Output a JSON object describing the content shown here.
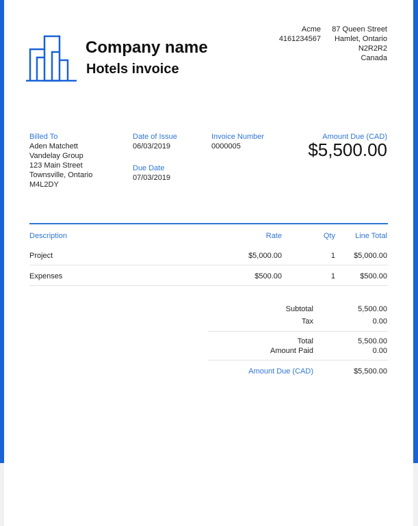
{
  "company": {
    "name": "Company name",
    "subtitle": "Hotels invoice"
  },
  "sender": {
    "name": "Acme",
    "phone": "4161234567",
    "address": [
      "87 Queen Street",
      "Hamlet, Ontario",
      "N2R2R2",
      "Canada"
    ]
  },
  "billed_to": {
    "label": "Billed To",
    "lines": [
      "Aden Matchett",
      "Vandelay Group",
      "123 Main Street",
      "Townsville, Ontario",
      "M4L2DY"
    ]
  },
  "dates": {
    "issue_label": "Date of Issue",
    "issue_value": "06/03/2019",
    "due_label": "Due Date",
    "due_value": "07/03/2019"
  },
  "invoice_number": {
    "label": "Invoice Number",
    "value": "0000005"
  },
  "amount_due": {
    "label": "Amount Due (CAD)",
    "value": "$5,500.00"
  },
  "table": {
    "headers": {
      "description": "Description",
      "rate": "Rate",
      "qty": "Qty",
      "line_total": "Line Total"
    },
    "rows": [
      {
        "description": "Project",
        "rate": "$5,000.00",
        "qty": "1",
        "line_total": "$5,000.00"
      },
      {
        "description": "Expenses",
        "rate": "$500.00",
        "qty": "1",
        "line_total": "$500.00"
      }
    ]
  },
  "totals": {
    "subtotal_label": "Subtotal",
    "subtotal_value": "5,500.00",
    "tax_label": "Tax",
    "tax_value": "0.00",
    "total_label": "Total",
    "total_value": "5,500.00",
    "paid_label": "Amount Paid",
    "paid_value": "0.00",
    "due_label": "Amount Due (CAD)",
    "due_value": "$5,500.00"
  },
  "colors": {
    "accent": "#2f76d2",
    "background": "#1a63d6"
  }
}
